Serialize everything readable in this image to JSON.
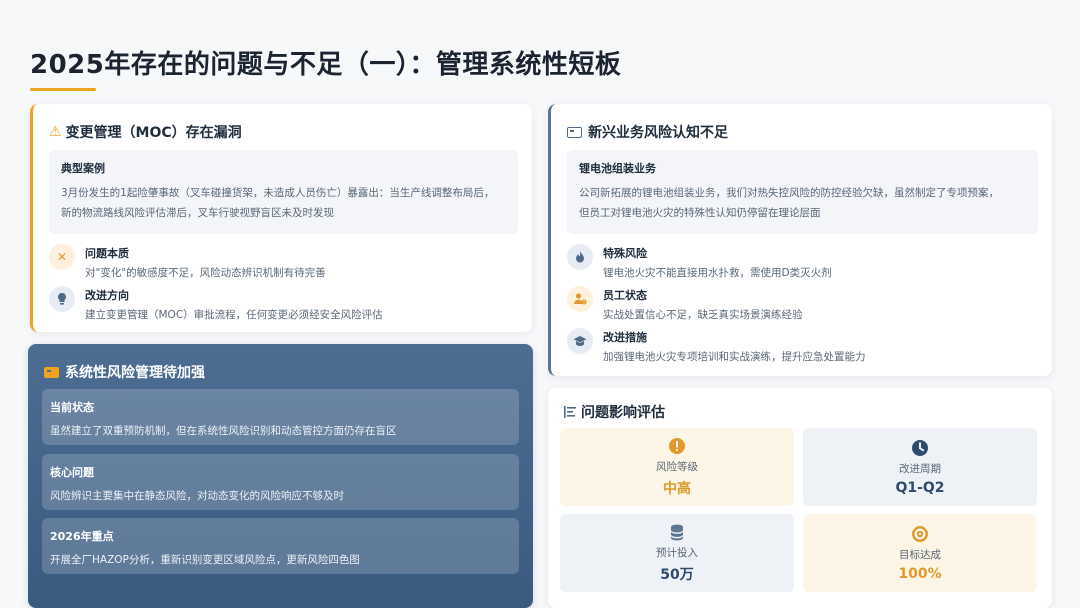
{
  "page": {
    "title": "2025年存在的问题与不足（一）：管理系统性短板"
  },
  "moc": {
    "title": "变更管理（MOC）存在漏洞",
    "case_label": "典型案例",
    "case_text_1": "3月份发生的1起险肇事故（叉车碰撞货架，未造成人员伤亡）暴露出：当生产线调整布局后，",
    "case_text_2": "新的物流路线风险评估滞后，叉车行驶视野盲区未及时发现",
    "items": [
      {
        "title": "问题本质",
        "text": "对\"变化\"的敏感度不足，风险动态辨识机制有待完善"
      },
      {
        "title": "改进方向",
        "text": "建立变更管理（MOC）审批流程，任何变更必须经安全风险评估"
      }
    ]
  },
  "new_biz": {
    "title": "新兴业务风险认知不足",
    "block_label": "锂电池组装业务",
    "block_text_1": "公司新拓展的锂电池组装业务，我们对热失控风险的防控经验欠缺，虽然制定了专项预案，",
    "block_text_2": "但员工对锂电池火灾的特殊性认知仍停留在理论层面",
    "items": [
      {
        "title": "特殊风险",
        "text": "锂电池火灾不能直接用水扑救，需使用D类灭火剂"
      },
      {
        "title": "员工状态",
        "text": "实战处置信心不足，缺乏真实场景演练经验"
      },
      {
        "title": "改进措施",
        "text": "加强锂电池火灾专项培训和实战演练，提升应急处置能力"
      }
    ]
  },
  "system": {
    "title": "系统性风险管理待加强",
    "blocks": [
      {
        "label": "当前状态",
        "text": "虽然建立了双重预防机制，但在系统性风险识别和动态管控方面仍存在盲区"
      },
      {
        "label": "核心问题",
        "text": "风险辨识主要集中在静态风险，对动态变化的风险响应不够及时"
      },
      {
        "label": "2026年重点",
        "text": "开展全厂HAZOP分析，重新识别变更区域风险点，更新风险四色图"
      }
    ]
  },
  "evaluation": {
    "title": "问题影响评估",
    "metrics": [
      {
        "label": "风险等级",
        "value": "中高",
        "icon": "exclamation-icon"
      },
      {
        "label": "改进周期",
        "value": "Q1-Q2",
        "icon": "clock-icon"
      },
      {
        "label": "预计投入",
        "value": "50万",
        "icon": "coins-icon"
      },
      {
        "label": "目标达成",
        "value": "100%",
        "icon": "target-icon"
      }
    ]
  },
  "colors": {
    "accent": "#f0a31c",
    "slate": "#4d6d92",
    "navy": "#2e4a6c"
  }
}
